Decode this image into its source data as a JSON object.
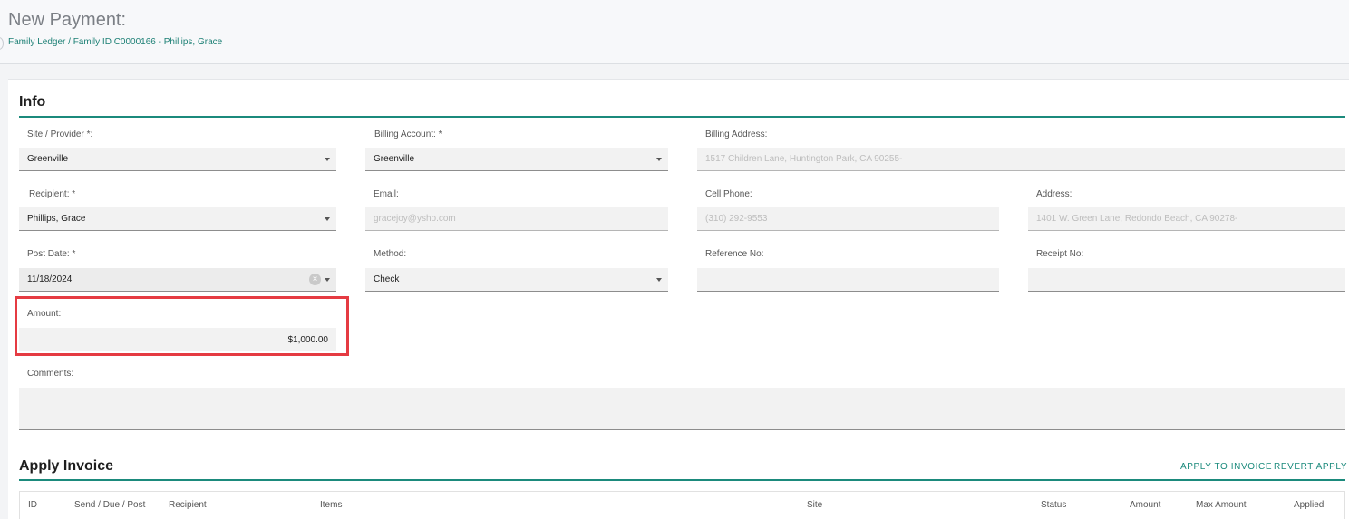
{
  "header": {
    "title": "New Payment:",
    "breadcrumb": "Family Ledger / Family ID C0000166 - Phillips, Grace"
  },
  "info": {
    "title": "Info",
    "site_provider": {
      "label": "Site / Provider *:",
      "value": "Greenville"
    },
    "billing_account": {
      "label": "Billing Account: *",
      "value": "Greenville"
    },
    "billing_address": {
      "label": "Billing Address:",
      "value": "1517 Children Lane, Huntington Park, CA 90255-"
    },
    "recipient": {
      "label": "Recipient: *",
      "value": "Phillips, Grace"
    },
    "email": {
      "label": "Email:",
      "value": "gracejoy@ysho.com"
    },
    "cell_phone": {
      "label": "Cell Phone:",
      "value": "(310) 292-9553"
    },
    "address": {
      "label": "Address:",
      "value": "1401 W. Green Lane, Redondo Beach, CA 90278-"
    },
    "post_date": {
      "label": "Post Date: *",
      "value": "11/18/2024"
    },
    "method": {
      "label": "Method:",
      "value": "Check"
    },
    "reference_no": {
      "label": "Reference No:",
      "value": ""
    },
    "receipt_no": {
      "label": "Receipt No:",
      "value": ""
    },
    "amount": {
      "label": "Amount:",
      "value": "$1,000.00"
    },
    "comments": {
      "label": "Comments:",
      "value": ""
    }
  },
  "apply_invoice": {
    "title": "Apply Invoice",
    "apply_button": "APPLY TO INVOICE",
    "revert_button": "REVERT APPLY",
    "columns": [
      "ID",
      "Send / Due / Post",
      "Recipient",
      "Items",
      "Site",
      "Status",
      "Amount",
      "Max Amount",
      "Applied"
    ]
  },
  "colors": {
    "accent": "#1b8a7c",
    "highlight": "#e53b42"
  },
  "icons": {
    "dropdown": "chevron-down-icon",
    "clear": "clear-icon"
  }
}
